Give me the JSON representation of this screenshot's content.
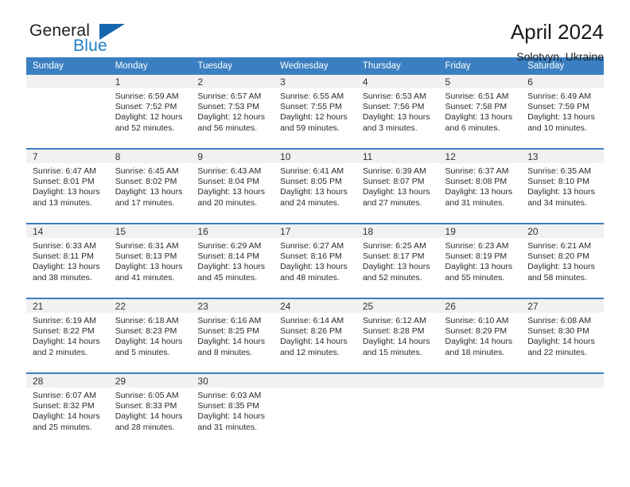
{
  "logo": {
    "word_top": "General",
    "word_bottom": "Blue",
    "triangle_icon": "triangle-icon"
  },
  "header": {
    "title": "April 2024",
    "location": "Solotvyn, Ukraine"
  },
  "colors": {
    "header_blue": "#3a7fc1",
    "logo_blue": "#1f7ec4",
    "daynum_band": "#f1f1f1",
    "text": "#2b2b2b"
  },
  "weekday_headers": [
    "Sunday",
    "Monday",
    "Tuesday",
    "Wednesday",
    "Thursday",
    "Friday",
    "Saturday"
  ],
  "labels": {
    "sunrise_prefix": "Sunrise:",
    "sunset_prefix": "Sunset:",
    "daylight_prefix": "Daylight:"
  },
  "weeks": [
    [
      {
        "day": "",
        "line1": "",
        "line2": "",
        "line3": "",
        "line4": ""
      },
      {
        "day": "1",
        "line1": "Sunrise: 6:59 AM",
        "line2": "Sunset: 7:52 PM",
        "line3": "Daylight: 12 hours",
        "line4": "and 52 minutes."
      },
      {
        "day": "2",
        "line1": "Sunrise: 6:57 AM",
        "line2": "Sunset: 7:53 PM",
        "line3": "Daylight: 12 hours",
        "line4": "and 56 minutes."
      },
      {
        "day": "3",
        "line1": "Sunrise: 6:55 AM",
        "line2": "Sunset: 7:55 PM",
        "line3": "Daylight: 12 hours",
        "line4": "and 59 minutes."
      },
      {
        "day": "4",
        "line1": "Sunrise: 6:53 AM",
        "line2": "Sunset: 7:56 PM",
        "line3": "Daylight: 13 hours",
        "line4": "and 3 minutes."
      },
      {
        "day": "5",
        "line1": "Sunrise: 6:51 AM",
        "line2": "Sunset: 7:58 PM",
        "line3": "Daylight: 13 hours",
        "line4": "and 6 minutes."
      },
      {
        "day": "6",
        "line1": "Sunrise: 6:49 AM",
        "line2": "Sunset: 7:59 PM",
        "line3": "Daylight: 13 hours",
        "line4": "and 10 minutes."
      }
    ],
    [
      {
        "day": "7",
        "line1": "Sunrise: 6:47 AM",
        "line2": "Sunset: 8:01 PM",
        "line3": "Daylight: 13 hours",
        "line4": "and 13 minutes."
      },
      {
        "day": "8",
        "line1": "Sunrise: 6:45 AM",
        "line2": "Sunset: 8:02 PM",
        "line3": "Daylight: 13 hours",
        "line4": "and 17 minutes."
      },
      {
        "day": "9",
        "line1": "Sunrise: 6:43 AM",
        "line2": "Sunset: 8:04 PM",
        "line3": "Daylight: 13 hours",
        "line4": "and 20 minutes."
      },
      {
        "day": "10",
        "line1": "Sunrise: 6:41 AM",
        "line2": "Sunset: 8:05 PM",
        "line3": "Daylight: 13 hours",
        "line4": "and 24 minutes."
      },
      {
        "day": "11",
        "line1": "Sunrise: 6:39 AM",
        "line2": "Sunset: 8:07 PM",
        "line3": "Daylight: 13 hours",
        "line4": "and 27 minutes."
      },
      {
        "day": "12",
        "line1": "Sunrise: 6:37 AM",
        "line2": "Sunset: 8:08 PM",
        "line3": "Daylight: 13 hours",
        "line4": "and 31 minutes."
      },
      {
        "day": "13",
        "line1": "Sunrise: 6:35 AM",
        "line2": "Sunset: 8:10 PM",
        "line3": "Daylight: 13 hours",
        "line4": "and 34 minutes."
      }
    ],
    [
      {
        "day": "14",
        "line1": "Sunrise: 6:33 AM",
        "line2": "Sunset: 8:11 PM",
        "line3": "Daylight: 13 hours",
        "line4": "and 38 minutes."
      },
      {
        "day": "15",
        "line1": "Sunrise: 6:31 AM",
        "line2": "Sunset: 8:13 PM",
        "line3": "Daylight: 13 hours",
        "line4": "and 41 minutes."
      },
      {
        "day": "16",
        "line1": "Sunrise: 6:29 AM",
        "line2": "Sunset: 8:14 PM",
        "line3": "Daylight: 13 hours",
        "line4": "and 45 minutes."
      },
      {
        "day": "17",
        "line1": "Sunrise: 6:27 AM",
        "line2": "Sunset: 8:16 PM",
        "line3": "Daylight: 13 hours",
        "line4": "and 48 minutes."
      },
      {
        "day": "18",
        "line1": "Sunrise: 6:25 AM",
        "line2": "Sunset: 8:17 PM",
        "line3": "Daylight: 13 hours",
        "line4": "and 52 minutes."
      },
      {
        "day": "19",
        "line1": "Sunrise: 6:23 AM",
        "line2": "Sunset: 8:19 PM",
        "line3": "Daylight: 13 hours",
        "line4": "and 55 minutes."
      },
      {
        "day": "20",
        "line1": "Sunrise: 6:21 AM",
        "line2": "Sunset: 8:20 PM",
        "line3": "Daylight: 13 hours",
        "line4": "and 58 minutes."
      }
    ],
    [
      {
        "day": "21",
        "line1": "Sunrise: 6:19 AM",
        "line2": "Sunset: 8:22 PM",
        "line3": "Daylight: 14 hours",
        "line4": "and 2 minutes."
      },
      {
        "day": "22",
        "line1": "Sunrise: 6:18 AM",
        "line2": "Sunset: 8:23 PM",
        "line3": "Daylight: 14 hours",
        "line4": "and 5 minutes."
      },
      {
        "day": "23",
        "line1": "Sunrise: 6:16 AM",
        "line2": "Sunset: 8:25 PM",
        "line3": "Daylight: 14 hours",
        "line4": "and 8 minutes."
      },
      {
        "day": "24",
        "line1": "Sunrise: 6:14 AM",
        "line2": "Sunset: 8:26 PM",
        "line3": "Daylight: 14 hours",
        "line4": "and 12 minutes."
      },
      {
        "day": "25",
        "line1": "Sunrise: 6:12 AM",
        "line2": "Sunset: 8:28 PM",
        "line3": "Daylight: 14 hours",
        "line4": "and 15 minutes."
      },
      {
        "day": "26",
        "line1": "Sunrise: 6:10 AM",
        "line2": "Sunset: 8:29 PM",
        "line3": "Daylight: 14 hours",
        "line4": "and 18 minutes."
      },
      {
        "day": "27",
        "line1": "Sunrise: 6:08 AM",
        "line2": "Sunset: 8:30 PM",
        "line3": "Daylight: 14 hours",
        "line4": "and 22 minutes."
      }
    ],
    [
      {
        "day": "28",
        "line1": "Sunrise: 6:07 AM",
        "line2": "Sunset: 8:32 PM",
        "line3": "Daylight: 14 hours",
        "line4": "and 25 minutes."
      },
      {
        "day": "29",
        "line1": "Sunrise: 6:05 AM",
        "line2": "Sunset: 8:33 PM",
        "line3": "Daylight: 14 hours",
        "line4": "and 28 minutes."
      },
      {
        "day": "30",
        "line1": "Sunrise: 6:03 AM",
        "line2": "Sunset: 8:35 PM",
        "line3": "Daylight: 14 hours",
        "line4": "and 31 minutes."
      },
      {
        "day": "",
        "line1": "",
        "line2": "",
        "line3": "",
        "line4": ""
      },
      {
        "day": "",
        "line1": "",
        "line2": "",
        "line3": "",
        "line4": ""
      },
      {
        "day": "",
        "line1": "",
        "line2": "",
        "line3": "",
        "line4": ""
      },
      {
        "day": "",
        "line1": "",
        "line2": "",
        "line3": "",
        "line4": ""
      }
    ]
  ]
}
